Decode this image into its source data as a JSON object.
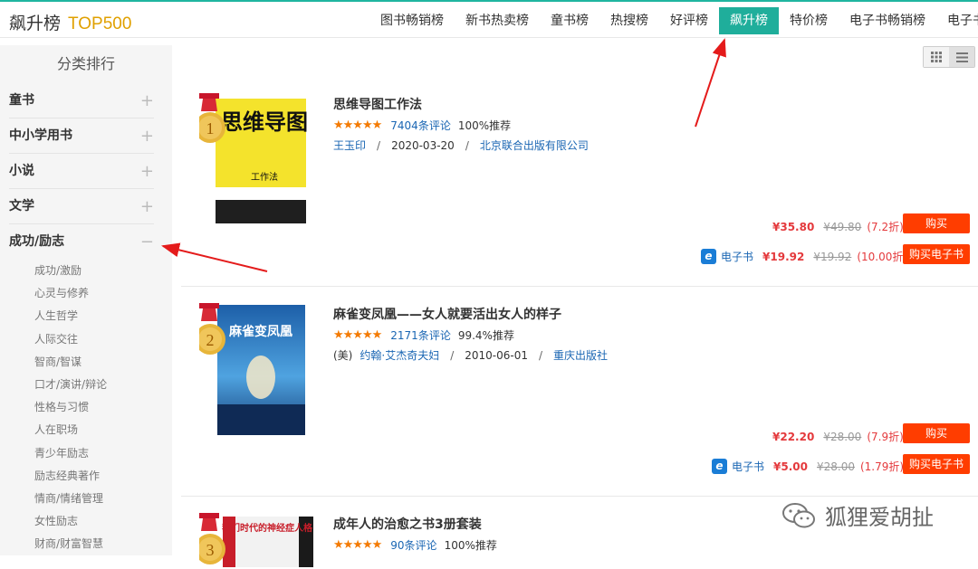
{
  "header": {
    "title": "飙升榜",
    "subtitle": "TOP500",
    "tabs": [
      "图书畅销榜",
      "新书热卖榜",
      "童书榜",
      "热搜榜",
      "好评榜",
      "飙升榜",
      "特价榜",
      "电子书畅销榜",
      "电子书"
    ],
    "active_tab": "飙升榜"
  },
  "sidebar": {
    "title": "分类排行",
    "categories": [
      {
        "label": "童书",
        "toggle": "+"
      },
      {
        "label": "中小学用书",
        "toggle": "+"
      },
      {
        "label": "小说",
        "toggle": "+"
      },
      {
        "label": "文学",
        "toggle": "+"
      },
      {
        "label": "成功/励志",
        "toggle": "−"
      }
    ],
    "subcategories": [
      "成功/激励",
      "心灵与修养",
      "人生哲学",
      "人际交往",
      "智商/智谋",
      "口才/演讲/辩论",
      "性格与习惯",
      "人在职场",
      "青少年励志",
      "励志经典著作",
      "情商/情绪管理",
      "女性励志",
      "财商/财富智慧"
    ]
  },
  "books": [
    {
      "rank": "1",
      "title": "思维导图工作法",
      "stars": "★★★★★",
      "reviews": "7404条评论",
      "recommend": "100%推荐",
      "author": "王玉印",
      "date": "2020-03-20",
      "publisher": "北京联合出版有限公司",
      "price": "¥35.80",
      "orig_price": "¥49.80",
      "discount": "(7.2折)",
      "buy_label": "购买",
      "ebook_label": "电子书",
      "ebook_price": "¥19.92",
      "ebook_orig": "¥19.92",
      "ebook_discount": "(10.00折)",
      "buy_ebook_label": "购买电子书",
      "cover_text": "思维导图",
      "cover_sub": "工作法"
    },
    {
      "rank": "2",
      "title": "麻雀变凤凰——女人就要活出女人的样子",
      "stars": "★★★★★",
      "reviews": "2171条评论",
      "recommend": "99.4%推荐",
      "author_prefix": "(美)",
      "author": "约翰·艾杰奇夫妇",
      "date": "2010-06-01",
      "publisher": "重庆出版社",
      "price": "¥22.20",
      "orig_price": "¥28.00",
      "discount": "(7.9折)",
      "buy_label": "购买",
      "ebook_label": "电子书",
      "ebook_price": "¥5.00",
      "ebook_orig": "¥28.00",
      "ebook_discount": "(1.79折)",
      "buy_ebook_label": "购买电子书",
      "cover_text": "麻雀变凤凰"
    },
    {
      "rank": "3",
      "title": "成年人的治愈之书3册套装",
      "stars": "★★★★★",
      "reviews": "90条评论",
      "recommend": "100%推荐",
      "cover_text": "我们时代的神经症人格"
    }
  ],
  "watermark": "狐狸爱胡扯",
  "colors": {
    "accent": "#1fae9b",
    "price": "#e4393c",
    "button": "#ff3d00",
    "link": "#1a66b3"
  }
}
